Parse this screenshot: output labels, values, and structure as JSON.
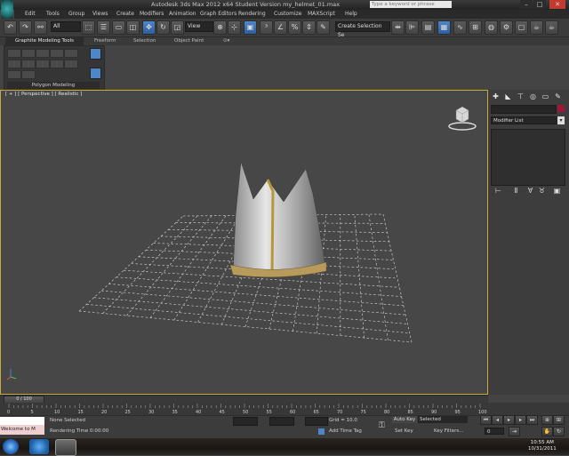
{
  "window": {
    "title": "Autodesk 3ds Max  2012 x64    Student Version    my_helmet_01.max",
    "search_placeholder": "Type a keyword or phrase",
    "min": "–",
    "max": "□",
    "close": "✕"
  },
  "menu": [
    "Edit",
    "Tools",
    "Group",
    "Views",
    "Create",
    "Modifiers",
    "Animation",
    "Graph Editors",
    "Rendering",
    "Customize",
    "MAXScript",
    "Help"
  ],
  "toolbar": {
    "selection_set": "All",
    "coord_system": "View",
    "named_sel_placeholder": "Create Selection Se"
  },
  "ribbon": {
    "tabs": [
      "Graphite Modeling Tools",
      "Freeform",
      "Selection",
      "Object Paint"
    ],
    "panel_label": "Polygon Modeling"
  },
  "viewport": {
    "label": "[ + ] [ Perspective ] [ Realistic ]",
    "border_color": "#c9a83c",
    "grid_color": "#dcdcdc"
  },
  "command_panel": {
    "tab_icons": [
      "create-icon",
      "modify-icon",
      "hierarchy-icon",
      "motion-icon",
      "display-icon",
      "utilities-icon"
    ],
    "modifier_list": "Modifier List",
    "object_color": "#a01638"
  },
  "timeline": {
    "frame_display": "0 / 100",
    "ticks": [
      "0",
      "5",
      "10",
      "15",
      "20",
      "25",
      "30",
      "35",
      "40",
      "45",
      "50",
      "55",
      "60",
      "65",
      "70",
      "75",
      "80",
      "85",
      "90",
      "95",
      "100"
    ]
  },
  "status": {
    "maxscript_label": "Welcome to M",
    "selection_status": "None Selected",
    "prompt": "Rendering Time  0:00:00",
    "grid_label": "Grid = 10.0",
    "add_time_tag": "Add Time Tag",
    "auto_key": "Auto Key",
    "selected_option": "Selected",
    "set_key": "Set Key",
    "key_filters": "Key Filters...",
    "frame_field": "0"
  },
  "taskbar": {
    "time": "10:55 AM",
    "date": "10/31/2011"
  }
}
